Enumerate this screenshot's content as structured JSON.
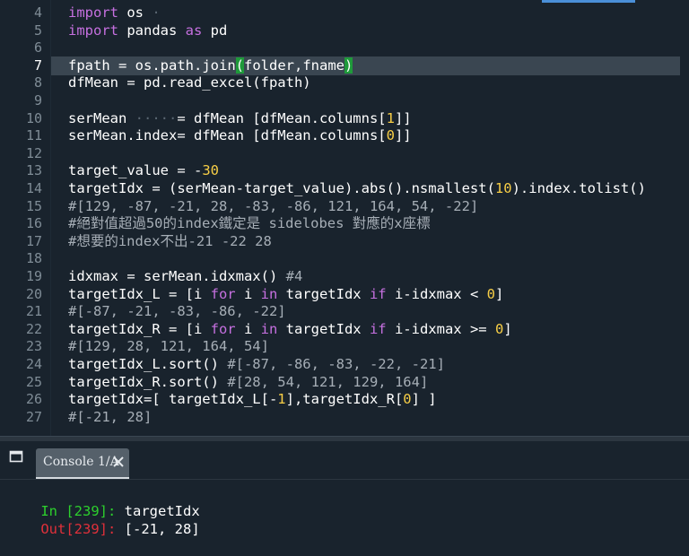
{
  "editor": {
    "gutter": {
      "line_numbers": [
        "4",
        "5",
        "6",
        "7",
        "8",
        "9",
        "10",
        "11",
        "12",
        "13",
        "14",
        "15",
        "16",
        "17",
        "18",
        "19",
        "20",
        "21",
        "22",
        "23",
        "24",
        "25",
        "26",
        "27"
      ],
      "current_line": "7"
    },
    "lines": [
      [
        {
          "t": "import",
          "c": "kw"
        },
        {
          "t": " os",
          "c": ""
        },
        {
          "t": " ·",
          "c": "dot"
        }
      ],
      [
        {
          "t": "import",
          "c": "kw"
        },
        {
          "t": " pandas ",
          "c": ""
        },
        {
          "t": "as",
          "c": "kw"
        },
        {
          "t": " pd",
          "c": ""
        }
      ],
      [],
      [
        {
          "t": "fpath",
          "c": ""
        },
        {
          "t": " = ",
          "c": ""
        },
        {
          "t": "os.path.join",
          "c": ""
        },
        {
          "t": "(",
          "c": "brk"
        },
        {
          "t": "folder,fname",
          "c": ""
        },
        {
          "t": ")",
          "c": "brk"
        }
      ],
      [
        {
          "t": "dfMean = pd.read_excel(fpath)",
          "c": ""
        }
      ],
      [],
      [
        {
          "t": "serMean ",
          "c": ""
        },
        {
          "t": "·····",
          "c": "dot"
        },
        {
          "t": "= dfMean [dfMean.columns[",
          "c": ""
        },
        {
          "t": "1",
          "c": "num"
        },
        {
          "t": "]]",
          "c": ""
        }
      ],
      [
        {
          "t": "serMean.index= dfMean [dfMean.columns[",
          "c": ""
        },
        {
          "t": "0",
          "c": "num"
        },
        {
          "t": "]]",
          "c": ""
        }
      ],
      [],
      [
        {
          "t": "target_value = -",
          "c": ""
        },
        {
          "t": "30",
          "c": "num"
        }
      ],
      [
        {
          "t": "targetIdx = (serMean-target_value).abs().nsmallest(",
          "c": ""
        },
        {
          "t": "10",
          "c": "num"
        },
        {
          "t": ").index.tolist()",
          "c": ""
        }
      ],
      [
        {
          "t": "#[129, -87, -21, 28, -83, -86, 121, 164, 54, -22]",
          "c": "cm"
        }
      ],
      [
        {
          "t": "#絕對值超過50的index鐵定是 sidelobes 對應的x座標",
          "c": "cm"
        }
      ],
      [
        {
          "t": "#想要的index不出-21 -22 28",
          "c": "cm"
        }
      ],
      [],
      [
        {
          "t": "idxmax = serMean.idxmax() ",
          "c": ""
        },
        {
          "t": "#4",
          "c": "cm"
        }
      ],
      [
        {
          "t": "targetIdx_L = [i ",
          "c": ""
        },
        {
          "t": "for",
          "c": "kw"
        },
        {
          "t": " i ",
          "c": ""
        },
        {
          "t": "in",
          "c": "kw"
        },
        {
          "t": " targetIdx ",
          "c": ""
        },
        {
          "t": "if",
          "c": "kw"
        },
        {
          "t": " i-idxmax < ",
          "c": ""
        },
        {
          "t": "0",
          "c": "num"
        },
        {
          "t": "]",
          "c": ""
        }
      ],
      [
        {
          "t": "#[-87, -21, -83, -86, -22]",
          "c": "cm"
        }
      ],
      [
        {
          "t": "targetIdx_R = [i ",
          "c": ""
        },
        {
          "t": "for",
          "c": "kw"
        },
        {
          "t": " i ",
          "c": ""
        },
        {
          "t": "in",
          "c": "kw"
        },
        {
          "t": " targetIdx ",
          "c": ""
        },
        {
          "t": "if",
          "c": "kw"
        },
        {
          "t": " i-idxmax >= ",
          "c": ""
        },
        {
          "t": "0",
          "c": "num"
        },
        {
          "t": "]",
          "c": ""
        }
      ],
      [
        {
          "t": "#[129, 28, 121, 164, 54]",
          "c": "cm"
        }
      ],
      [
        {
          "t": "targetIdx_L.sort() ",
          "c": ""
        },
        {
          "t": "#[-87, -86, -83, -22, -21]",
          "c": "cm"
        }
      ],
      [
        {
          "t": "targetIdx_R.sort() ",
          "c": ""
        },
        {
          "t": "#[28, 54, 121, 129, 164]",
          "c": "cm"
        }
      ],
      [
        {
          "t": "targetIdx=[ targetIdx_L[-",
          "c": ""
        },
        {
          "t": "1",
          "c": "num"
        },
        {
          "t": "],targetIdx_R[",
          "c": ""
        },
        {
          "t": "0",
          "c": "num"
        },
        {
          "t": "] ]",
          "c": ""
        }
      ],
      [
        {
          "t": "#[-21, 28]",
          "c": "cm"
        }
      ]
    ]
  },
  "console": {
    "tab_label": "Console 1/A",
    "in_prompt": "In [239]:",
    "in_text": " targetIdx",
    "out_prompt": "Out[239]:",
    "out_text": " [-21, 28]"
  },
  "icons": {
    "panel_icon": "window-icon",
    "tab_close": "close-icon"
  },
  "colors": {
    "background": "#19232d",
    "keyword": "#c670e0",
    "number": "#f7ce46",
    "comment": "#a6aeb6",
    "bracket_match": "#1f9a3a",
    "in_prompt": "#2dd02d",
    "out_prompt": "#e0303a"
  }
}
